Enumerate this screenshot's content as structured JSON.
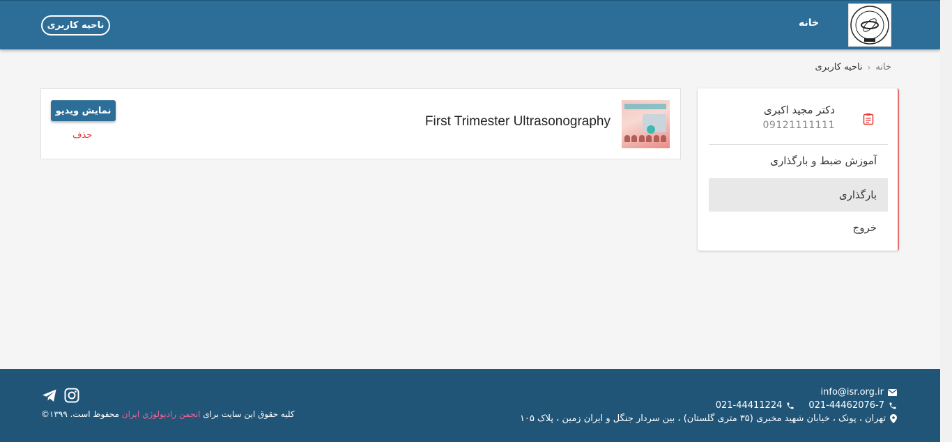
{
  "header": {
    "home_label": "خانه",
    "account_label": "ناحیه کاربری"
  },
  "breadcrumb": {
    "home": "خانه",
    "current": "ناحیه کاربری"
  },
  "profile": {
    "name": "دکتر مجید اکبری",
    "phone": "09121111111"
  },
  "side_menu": [
    {
      "label": "آموزش ضبط و بارگذاری",
      "active": false
    },
    {
      "label": "بارگذاری",
      "active": true
    },
    {
      "label": "خروج",
      "active": false
    }
  ],
  "video": {
    "title": "First Trimester Ultrasonography",
    "show_label": "نمایش ویدیو",
    "delete_label": "حذف"
  },
  "footer": {
    "email": "info@isr.org.ir",
    "phone1": "021-44462076-7",
    "phone2": "021-44411224",
    "address": "تهران ، پونک ، خیابان شهید مخبری (۳۵ متری گلستان) ، بین سردار جنگل و ایران زمین ، پلاک ۱۰۵",
    "copyright_prefix": "کلیه حقوق این سایت برای",
    "copyright_org": "انجمن راديولوژي ايران",
    "copyright_suffix": "محفوظ است. ۱۳۹۹©"
  },
  "colors": {
    "primary": "#2d6e99",
    "footer": "#205578",
    "danger": "#e53935",
    "accent_pink": "#f06292"
  }
}
